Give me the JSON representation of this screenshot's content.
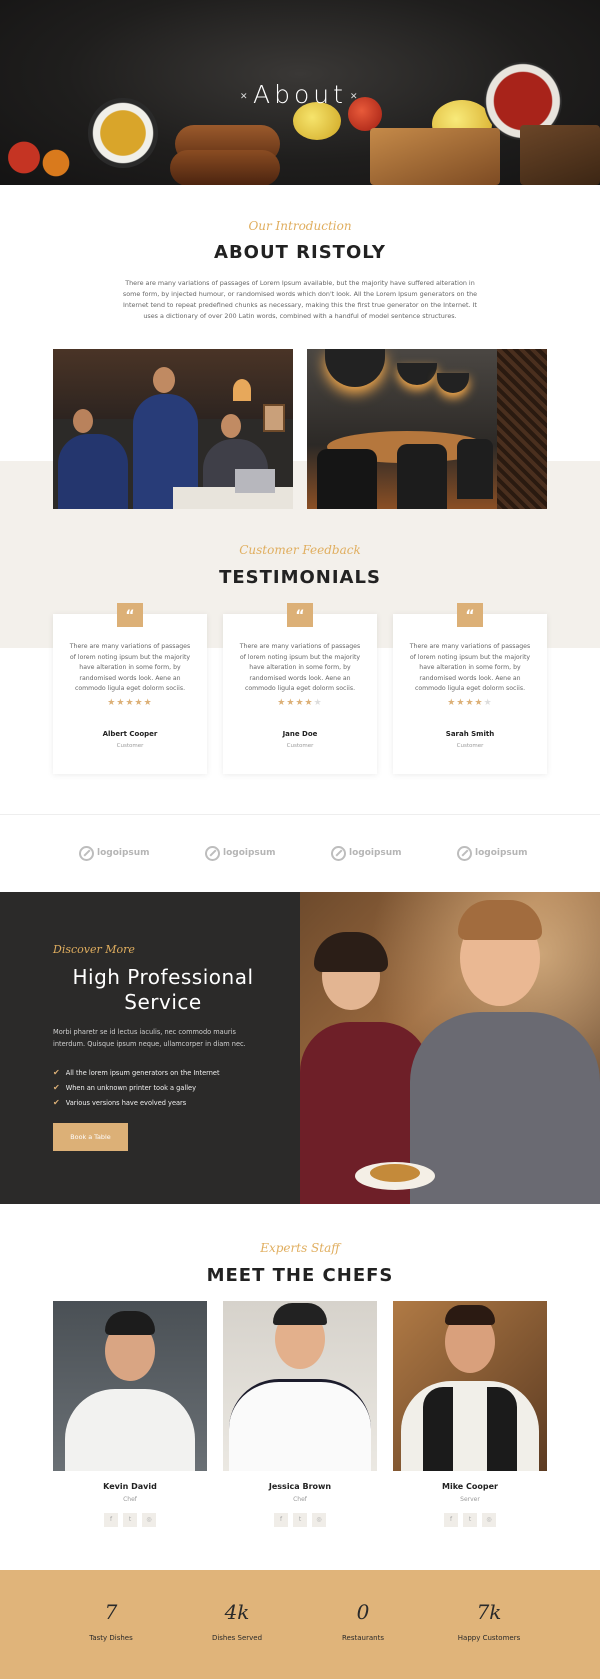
{
  "hero": {
    "title": "About"
  },
  "intro": {
    "subtitle": "Our Introduction",
    "title": "ABOUT RISTOLY",
    "text": "There are many variations of passages of Lorem Ipsum available, but the majority have suffered alteration in some form, by injected humour, or randomised words which don't look. All the Lorem Ipsum generators on the Internet tend to repeat predefined chunks as necessary, making this the first true generator on the Internet. It uses a dictionary of over 200 Latin words, combined with a handful of model sentence structures."
  },
  "testimonials": {
    "subtitle": "Customer Feedback",
    "title": "TESTIMONIALS",
    "items": [
      {
        "text": "There are many variations of passages of lorem noting ipsum but the majority have alteration in some form, by randomised words look. Aene an commodo ligula eget dolorm sociis.",
        "rating": 5,
        "name": "Albert Cooper",
        "role": "Customer"
      },
      {
        "text": "There are many variations of passages of lorem noting ipsum but the majority have alteration in some form, by randomised words look. Aene an commodo ligula eget dolorm sociis.",
        "rating": 4,
        "name": "Jane Doe",
        "role": "Customer"
      },
      {
        "text": "There are many variations of passages of lorem noting ipsum but the majority have alteration in some form, by randomised words look. Aene an commodo ligula eget dolorm sociis.",
        "rating": 4,
        "name": "Sarah Smith",
        "role": "Customer"
      }
    ]
  },
  "logos": [
    "logoipsum",
    "logoipsum",
    "logoipsum",
    "logoipsum"
  ],
  "service": {
    "subtitle": "Discover More",
    "title": "High Professional Service",
    "text": "Morbi pharetr se id lectus iaculis, nec commodo mauris interdum. Quisque ipsum neque, ullamcorper in diam nec.",
    "checklist": [
      "All the lorem ipsum generators on the Internet",
      "When an unknown printer took a galley",
      "Various versions have evolved years"
    ],
    "button": "Book a Table"
  },
  "chefs": {
    "subtitle": "Experts Staff",
    "title": "MEET THE CHEFS",
    "items": [
      {
        "name": "Kevin David",
        "role": "Chef"
      },
      {
        "name": "Jessica Brown",
        "role": "Chef"
      },
      {
        "name": "Mike Cooper",
        "role": "Server"
      }
    ]
  },
  "stats": [
    {
      "number": "7",
      "label": "Tasty Dishes"
    },
    {
      "number": "4k",
      "label": "Dishes Served"
    },
    {
      "number": "0",
      "label": "Restaurants"
    },
    {
      "number": "7k",
      "label": "Happy Customers"
    }
  ],
  "icons": {
    "quote": "quote-icon",
    "star": "star-icon",
    "check": "check-icon",
    "facebook": "facebook-icon",
    "twitter": "twitter-icon",
    "instagram": "instagram-icon"
  },
  "colors": {
    "accent": "#dcb077",
    "dark": "#2b2a29",
    "band": "#f3f0eb",
    "stats_bg": "#e0b47a"
  }
}
